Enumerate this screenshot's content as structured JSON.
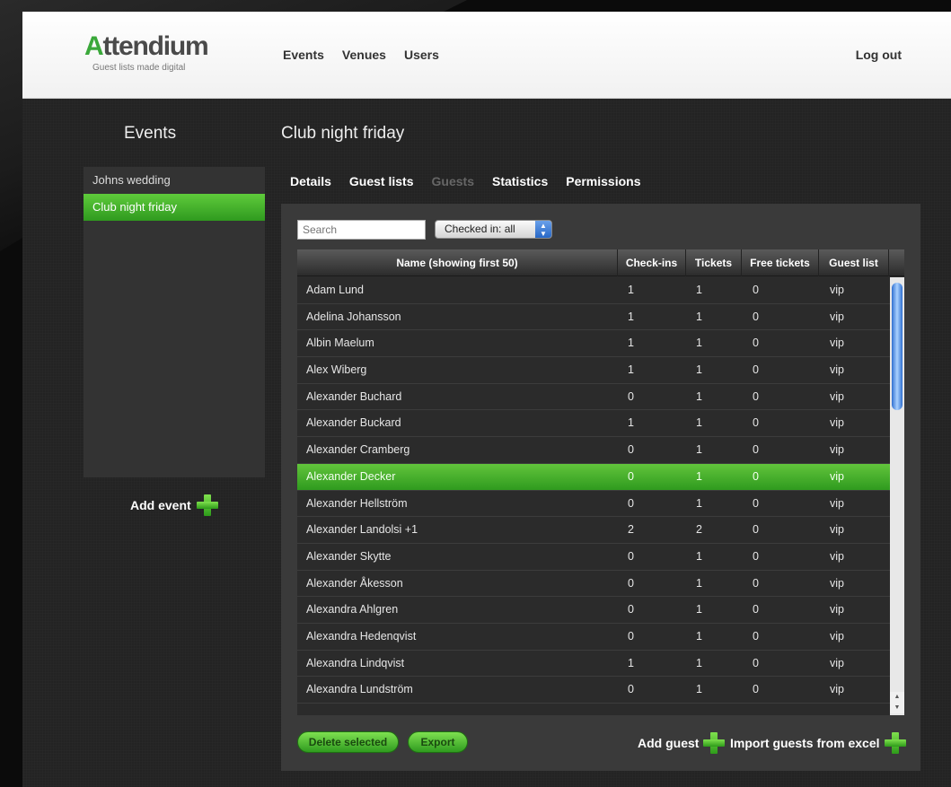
{
  "header": {
    "logo_text_first": "A",
    "logo_text_rest": "ttendium",
    "tagline": "Guest lists made digital",
    "nav": [
      "Events",
      "Venues",
      "Users"
    ],
    "logout": "Log out"
  },
  "sidebar": {
    "title": "Events",
    "events": [
      {
        "label": "Johns wedding",
        "active": false
      },
      {
        "label": "Club night friday",
        "active": true
      }
    ],
    "add_event": "Add event"
  },
  "main": {
    "title": "Club night friday",
    "tabs": [
      {
        "label": "Details",
        "disabled": false
      },
      {
        "label": "Guest lists",
        "disabled": false
      },
      {
        "label": "Guests",
        "disabled": true
      },
      {
        "label": "Statistics",
        "disabled": false
      },
      {
        "label": "Permissions",
        "disabled": false
      }
    ],
    "search_placeholder": "Search",
    "filter_value": "Checked in: all",
    "columns": [
      "Name (showing first 50)",
      "Check-ins",
      "Tickets",
      "Free tickets",
      "Guest list"
    ],
    "rows": [
      [
        "Adam Lund",
        "1",
        "1",
        "0",
        "vip"
      ],
      [
        "Adelina Johansson",
        "1",
        "1",
        "0",
        "vip"
      ],
      [
        "Albin Maelum",
        "1",
        "1",
        "0",
        "vip"
      ],
      [
        "Alex Wiberg",
        "1",
        "1",
        "0",
        "vip"
      ],
      [
        "Alexander Buchard",
        "0",
        "1",
        "0",
        "vip"
      ],
      [
        "Alexander Buckard",
        "1",
        "1",
        "0",
        "vip"
      ],
      [
        "Alexander Cramberg",
        "0",
        "1",
        "0",
        "vip"
      ],
      [
        "Alexander Decker",
        "0",
        "1",
        "0",
        "vip"
      ],
      [
        "Alexander Hellström",
        "0",
        "1",
        "0",
        "vip"
      ],
      [
        "Alexander Landolsi +1",
        "2",
        "2",
        "0",
        "vip"
      ],
      [
        "Alexander Skytte",
        "0",
        "1",
        "0",
        "vip"
      ],
      [
        "Alexander Åkesson",
        "0",
        "1",
        "0",
        "vip"
      ],
      [
        "Alexandra Ahlgren",
        "0",
        "1",
        "0",
        "vip"
      ],
      [
        "Alexandra Hedenqvist",
        "0",
        "1",
        "0",
        "vip"
      ],
      [
        "Alexandra Lindqvist",
        "1",
        "1",
        "0",
        "vip"
      ],
      [
        "Alexandra Lundström",
        "0",
        "1",
        "0",
        "vip"
      ]
    ],
    "selected_row_index": 7,
    "buttons": {
      "delete": "Delete selected",
      "export": "Export",
      "add_guest": "Add guest",
      "import": "Import guests from excel"
    }
  },
  "colors": {
    "accent_green": "#3aa83a",
    "panel": "#3a3a3a",
    "background": "#232323"
  }
}
